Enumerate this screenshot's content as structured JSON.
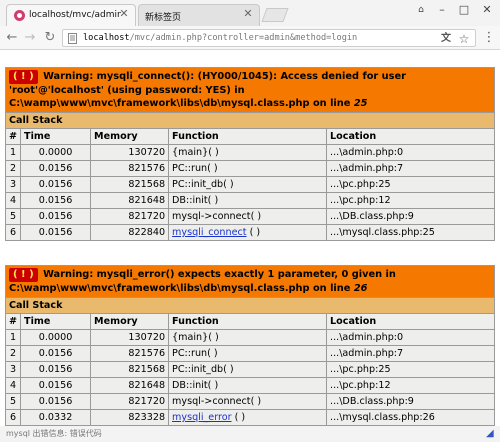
{
  "browser": {
    "tabs": [
      {
        "title": "localhost/mvc/admin.ph",
        "active": true
      },
      {
        "title": "新标签页",
        "active": false
      }
    ],
    "url_host": "localhost",
    "url_rest": "/mvc/admin.php?controller=admin&method=login",
    "icons": {
      "close": "✕",
      "minimize": "–",
      "maximize": "□",
      "window_close": "✕",
      "back": "←",
      "forward": "→",
      "reload": "↻",
      "translate": "文",
      "star": "☆",
      "menu": "⋮",
      "user": "⌂"
    }
  },
  "errors": [
    {
      "mark": "( ! )",
      "message": "Warning: mysqli_connect(): (HY000/1045): Access denied for user 'root'@'localhost' (using password: YES) in C:\\wamp\\www\\mvc\\framework\\libs\\db\\mysql.class.php on line ",
      "line": "25",
      "call_stack_label": "Call Stack",
      "columns": [
        "#",
        "Time",
        "Memory",
        "Function",
        "Location"
      ],
      "rows": [
        {
          "num": "1",
          "time": "0.0000",
          "memory": "130720",
          "function": "{main}( )",
          "link": false,
          "location": "...\\admin.php:0"
        },
        {
          "num": "2",
          "time": "0.0156",
          "memory": "821576",
          "function": "PC::run( )",
          "link": false,
          "location": "...\\admin.php:7"
        },
        {
          "num": "3",
          "time": "0.0156",
          "memory": "821568",
          "function": "PC::init_db( )",
          "link": false,
          "location": "...\\pc.php:25"
        },
        {
          "num": "4",
          "time": "0.0156",
          "memory": "821648",
          "function": "DB::init( )",
          "link": false,
          "location": "...\\pc.php:12"
        },
        {
          "num": "5",
          "time": "0.0156",
          "memory": "821720",
          "function": "mysql->connect( )",
          "link": false,
          "location": "...\\DB.class.php:9"
        },
        {
          "num": "6",
          "time": "0.0156",
          "memory": "822840",
          "function": "mysqli_connect",
          "function_suffix": " ( )",
          "link": true,
          "location": "...\\mysql.class.php:25"
        }
      ]
    },
    {
      "mark": "( ! )",
      "message": "Warning: mysqli_error() expects exactly 1 parameter, 0 given in C:\\wamp\\www\\mvc\\framework\\libs\\db\\mysql.class.php on line ",
      "line": "26",
      "call_stack_label": "Call Stack",
      "columns": [
        "#",
        "Time",
        "Memory",
        "Function",
        "Location"
      ],
      "rows": [
        {
          "num": "1",
          "time": "0.0000",
          "memory": "130720",
          "function": "{main}( )",
          "link": false,
          "location": "...\\admin.php:0"
        },
        {
          "num": "2",
          "time": "0.0156",
          "memory": "821576",
          "function": "PC::run( )",
          "link": false,
          "location": "...\\admin.php:7"
        },
        {
          "num": "3",
          "time": "0.0156",
          "memory": "821568",
          "function": "PC::init_db( )",
          "link": false,
          "location": "...\\pc.php:25"
        },
        {
          "num": "4",
          "time": "0.0156",
          "memory": "821648",
          "function": "DB::init( )",
          "link": false,
          "location": "...\\pc.php:12"
        },
        {
          "num": "5",
          "time": "0.0156",
          "memory": "821720",
          "function": "mysql->connect( )",
          "link": false,
          "location": "...\\DB.class.php:9"
        },
        {
          "num": "6",
          "time": "0.0332",
          "memory": "823328",
          "function": "mysqli_error",
          "function_suffix": " ( )",
          "link": true,
          "location": "...\\mysql.class.php:26"
        }
      ]
    }
  ],
  "status_text": "mysql 出错信息: 错误代码"
}
